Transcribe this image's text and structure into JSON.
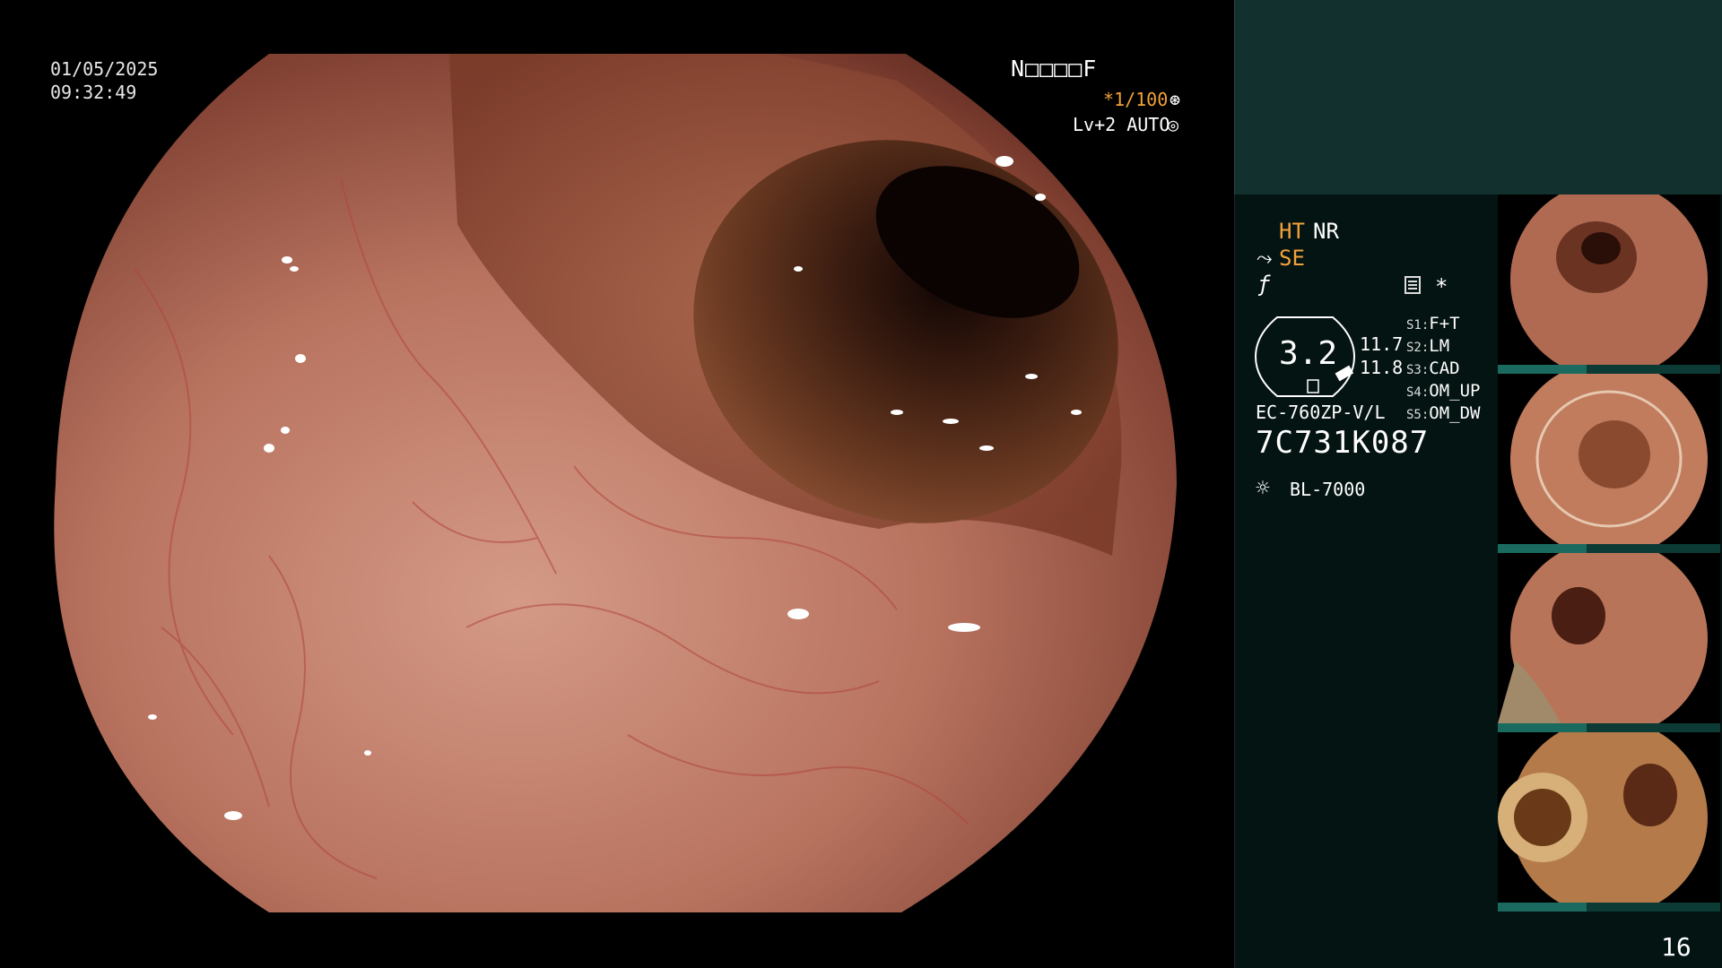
{
  "overlay": {
    "date": "01/05/2025",
    "time": "09:32:49",
    "patient_code": "N□□□□F",
    "shutter": "*1/100",
    "shutter_icon": "aperture-icon",
    "level": "Lv+2 AUTO",
    "level_icon": "iris-icon"
  },
  "side_panel": {
    "ht": "HT",
    "nr": "NR",
    "se_icon": "pump-icon",
    "se": "SE",
    "f_icon": "freeze-icon",
    "memo_icon": "memo-icon",
    "star": "*",
    "gauge_value": "3.2",
    "gauge_top": "11.7",
    "gauge_bottom": "11.8",
    "slots": [
      {
        "key": "S1:",
        "value": "F+T"
      },
      {
        "key": "S2:",
        "value": "LM"
      },
      {
        "key": "S3:",
        "value": "CAD"
      },
      {
        "key": "S4:",
        "value": "OM_UP"
      },
      {
        "key": "S5:",
        "value": "OM_DW"
      }
    ],
    "model": "EC-760ZP-V/L",
    "serial": "7C731K087",
    "lamp_icon": "light-source-icon",
    "lamp": "BL-7000"
  },
  "page_number": "16",
  "colors": {
    "accent_orange": "#f2a23a",
    "panel_top": "#12302d",
    "panel_bg": "#041412",
    "mucosa": "#b4705c"
  }
}
